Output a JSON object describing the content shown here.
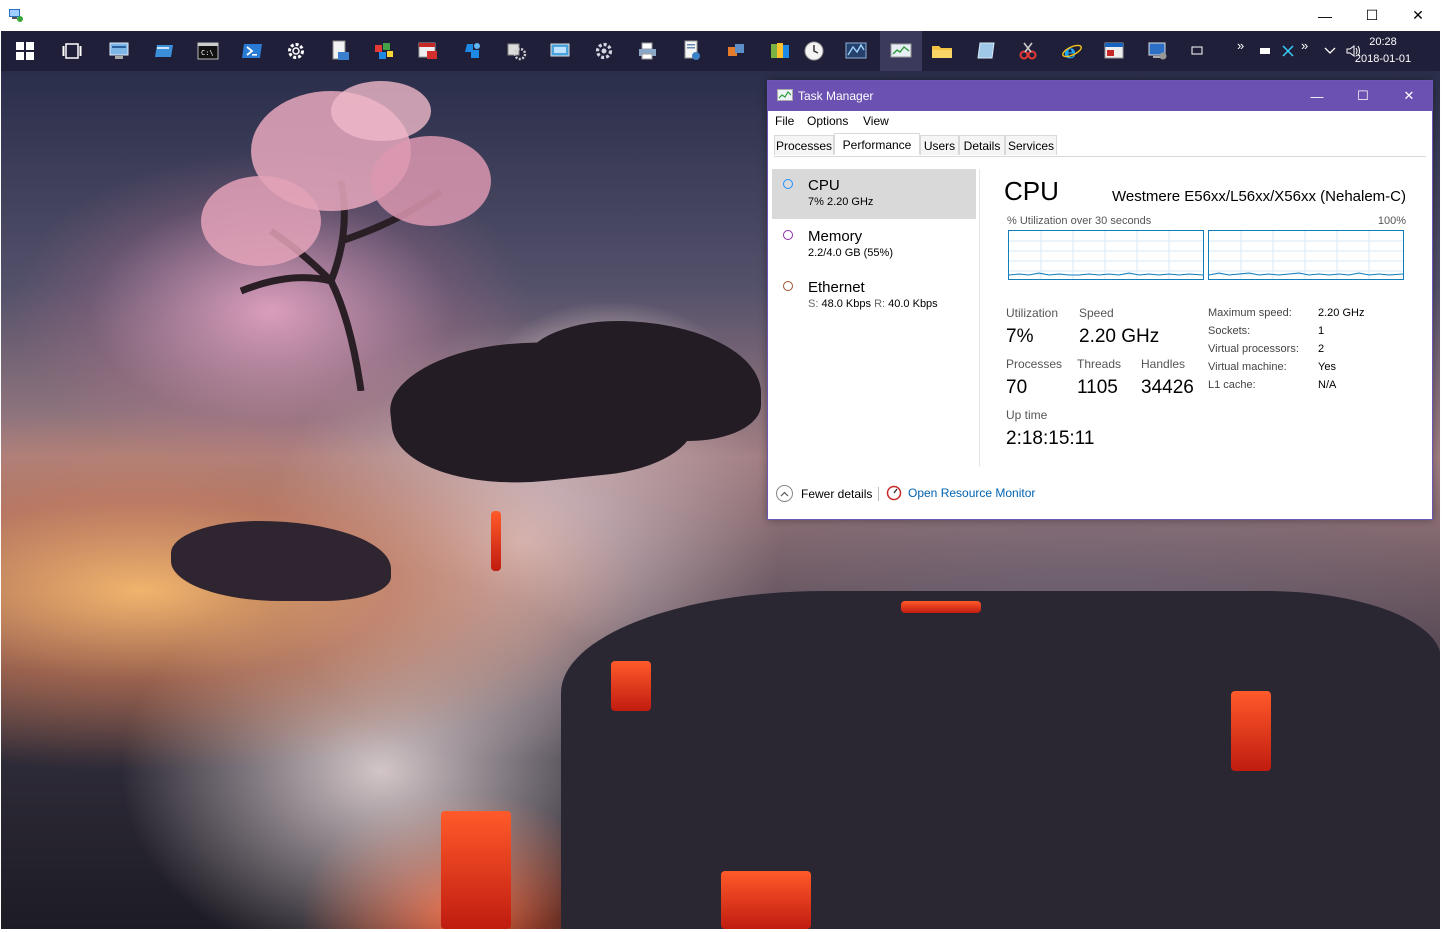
{
  "window": {
    "minimize": "—",
    "maximize": "☐",
    "close": "✕"
  },
  "taskbar": {
    "clock_time": "20:28",
    "clock_date": "2018-01-01",
    "tray_chevron": "»",
    "tray_chevron2": "»"
  },
  "taskmanager": {
    "title": "Task Manager",
    "menu": [
      "File",
      "Options",
      "View"
    ],
    "tabs": [
      "Processes",
      "Performance",
      "Users",
      "Details",
      "Services"
    ],
    "sidebar": [
      {
        "name": "CPU",
        "sub": "7%  2.20 GHz",
        "color": "#1e90ff"
      },
      {
        "name": "Memory",
        "sub": "2.2/4.0 GB (55%)",
        "color": "#8b2ea6"
      },
      {
        "name": "Ethernet",
        "sub_s_label": "S:",
        "sub_s": "48.0 Kbps",
        "sub_r_label": "R:",
        "sub_r": "40.0 Kbps",
        "color": "#a0522d"
      }
    ],
    "cpu": {
      "heading": "CPU",
      "model": "Westmere E56xx/L56xx/X56xx (Nehalem-C)",
      "graph_label": "% Utilization over 30 seconds",
      "graph_max": "100%",
      "utilization_label": "Utilization",
      "utilization": "7%",
      "speed_label": "Speed",
      "speed": "2.20 GHz",
      "processes_label": "Processes",
      "processes": "70",
      "threads_label": "Threads",
      "threads": "1105",
      "handles_label": "Handles",
      "handles": "34426",
      "uptime_label": "Up time",
      "uptime": "2:18:15:11",
      "specs": [
        {
          "label": "Maximum speed:",
          "value": "2.20 GHz"
        },
        {
          "label": "Sockets:",
          "value": "1"
        },
        {
          "label": "Virtual processors:",
          "value": "2"
        },
        {
          "label": "Virtual machine:",
          "value": "Yes"
        },
        {
          "label": "L1 cache:",
          "value": "N/A"
        }
      ]
    },
    "footer": {
      "fewer": "Fewer details",
      "resmon": "Open Resource Monitor"
    }
  }
}
